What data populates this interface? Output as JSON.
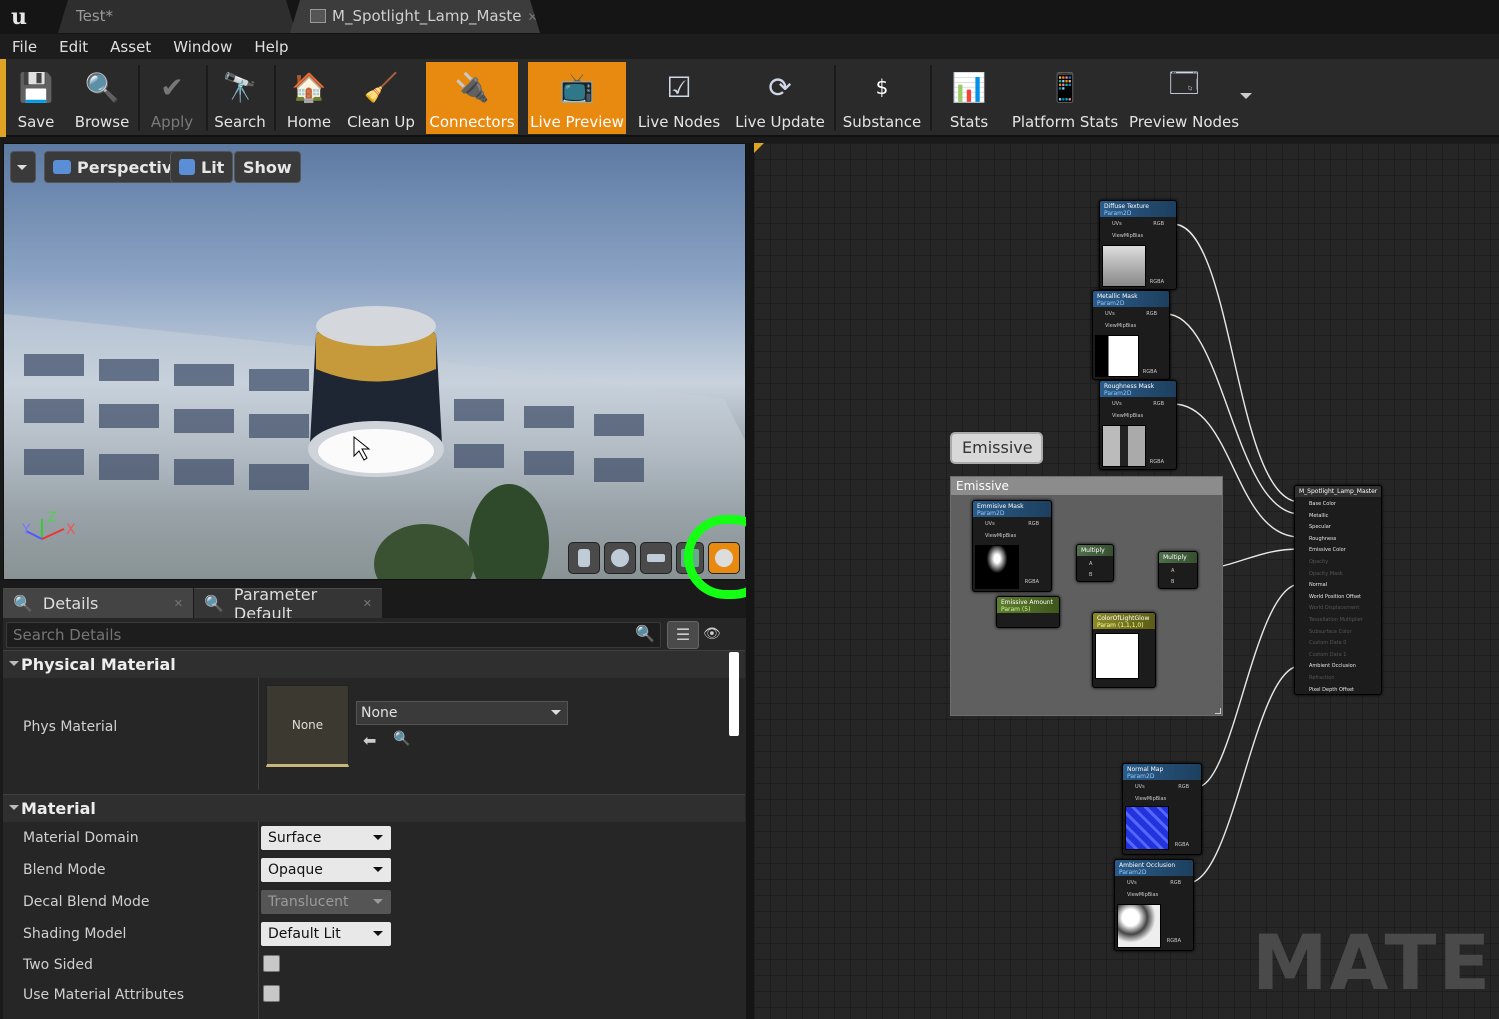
{
  "tabs": [
    {
      "label": "Test*"
    },
    {
      "label": "M_Spotlight_Lamp_Maste"
    }
  ],
  "menu": [
    "File",
    "Edit",
    "Asset",
    "Window",
    "Help"
  ],
  "toolbar": {
    "buttons": [
      {
        "label": "Save",
        "icon": "save-icon",
        "state": "normal"
      },
      {
        "label": "Browse",
        "icon": "browse-icon",
        "state": "normal"
      },
      {
        "label": "Apply",
        "icon": "apply-icon",
        "state": "disabled"
      },
      {
        "label": "Search",
        "icon": "search-icon",
        "state": "normal"
      },
      {
        "label": "Home",
        "icon": "home-icon",
        "state": "normal"
      },
      {
        "label": "Clean Up",
        "icon": "clean-up-icon",
        "state": "normal"
      },
      {
        "label": "Connectors",
        "icon": "connectors-icon",
        "state": "active"
      },
      {
        "label": "Live Preview",
        "icon": "live-preview-icon",
        "state": "active"
      },
      {
        "label": "Live Nodes",
        "icon": "live-nodes-icon",
        "state": "normal"
      },
      {
        "label": "Live Update",
        "icon": "live-update-icon",
        "state": "normal"
      },
      {
        "label": "Substance",
        "icon": "substance-icon",
        "state": "normal"
      },
      {
        "label": "Stats",
        "icon": "stats-icon",
        "state": "normal"
      },
      {
        "label": "Platform Stats",
        "icon": "platform-stats-icon",
        "state": "normal"
      },
      {
        "label": "Preview Nodes",
        "icon": "preview-nodes-icon",
        "state": "normal"
      }
    ]
  },
  "viewport": {
    "view_mode": "Perspective",
    "lighting": "Lit",
    "show": "Show",
    "axis": {
      "x": "X",
      "y": "Y",
      "z": "Z"
    }
  },
  "panel_tabs": [
    {
      "label": "Details"
    },
    {
      "label": "Parameter Default"
    }
  ],
  "details": {
    "search_placeholder": "Search Details",
    "physical_material": {
      "title": "Physical Material",
      "phys_label": "Phys Material",
      "thumb_text": "None",
      "dropdown_value": "None"
    },
    "material": {
      "title": "Material",
      "rows": [
        {
          "label": "Material Domain",
          "value": "Surface",
          "kind": "dropdown",
          "enabled": true
        },
        {
          "label": "Blend Mode",
          "value": "Opaque",
          "kind": "dropdown",
          "enabled": true
        },
        {
          "label": "Decal Blend Mode",
          "value": "Translucent",
          "kind": "dropdown",
          "enabled": false
        },
        {
          "label": "Shading Model",
          "value": "Default Lit",
          "kind": "dropdown",
          "enabled": true
        },
        {
          "label": "Two Sided",
          "value": "",
          "kind": "checkbox",
          "enabled": true
        },
        {
          "label": "Use Material Attributes",
          "value": "",
          "kind": "checkbox",
          "enabled": true
        }
      ]
    }
  },
  "graph": {
    "comment": {
      "bubble": "Emissive",
      "title": "Emissive"
    },
    "watermark": "MATERI",
    "texture_pins": {
      "uvs": "UVs",
      "mip": "ViewMipBias",
      "rgb": "RGB",
      "r": "R",
      "g": "G",
      "b": "B",
      "a": "A",
      "rgba": "RGBA"
    },
    "nodes": {
      "diffuse": {
        "title": "Diffuse Texture",
        "sub": "Param2D"
      },
      "metallic": {
        "title": "Metallic Mask",
        "sub": "Param2D"
      },
      "roughness": {
        "title": "Roughness Mask",
        "sub": "Param2D"
      },
      "emissive_mask": {
        "title": "Emmisive Mask",
        "sub": "Param2D"
      },
      "emissive_amount": {
        "title": "Emissive Amount",
        "sub": "Param (5)"
      },
      "multiply1": {
        "title": "Multiply",
        "a": "A",
        "b": "B"
      },
      "multiply2": {
        "title": "Multiply",
        "a": "A",
        "b": "B"
      },
      "color_glow": {
        "title": "ColorOfLightGlow",
        "sub": "Param (1,1,1,0)"
      },
      "normal": {
        "title": "Normal Map",
        "sub": "Param2D"
      },
      "ao": {
        "title": "Ambient Occlusion",
        "sub": "Param2D"
      },
      "master": {
        "title": "M_Spotlight_Lamp_Master",
        "inputs": [
          "Base Color",
          "Metallic",
          "Specular",
          "Roughness",
          "Emissive Color",
          "Opacity",
          "Opacity Mask",
          "Normal",
          "World Position Offset",
          "World Displacement",
          "Tessellation Multiplier",
          "Subsurface Color",
          "Custom Data 0",
          "Custom Data 1",
          "Ambient Occlusion",
          "Refraction",
          "Pixel Depth Offset"
        ]
      }
    }
  },
  "colors": {
    "accent": "#e88a10",
    "highlight": "#14ff14"
  }
}
